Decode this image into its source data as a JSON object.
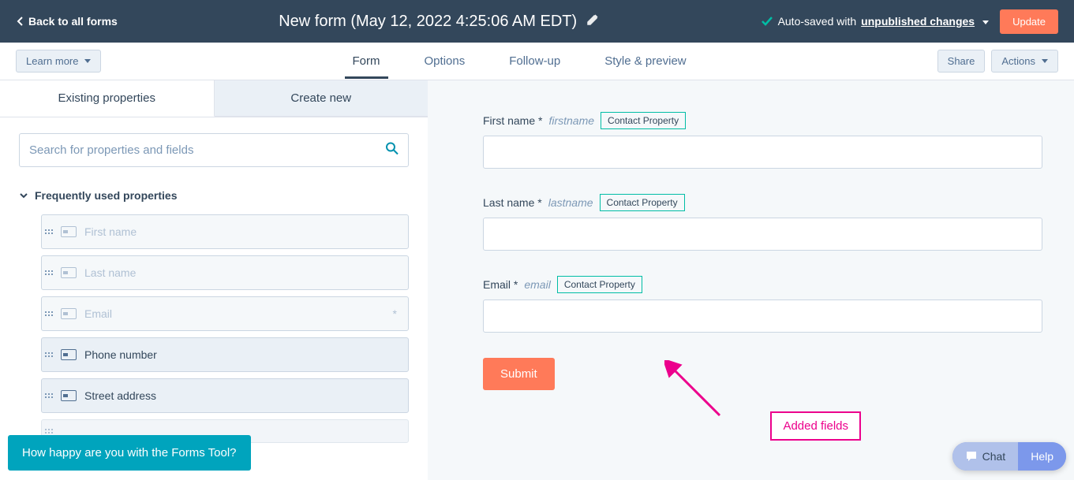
{
  "topbar": {
    "back_label": "Back to all forms",
    "title": "New form (May 12, 2022 4:25:06 AM EDT)",
    "autosave_prefix": "Auto-saved with ",
    "autosave_link": "unpublished changes",
    "update_label": "Update"
  },
  "secondbar": {
    "learn_more": "Learn more",
    "tabs": [
      {
        "label": "Form",
        "active": true
      },
      {
        "label": "Options",
        "active": false
      },
      {
        "label": "Follow-up",
        "active": false
      },
      {
        "label": "Style & preview",
        "active": false
      }
    ],
    "share": "Share",
    "actions": "Actions"
  },
  "left": {
    "tabs": {
      "existing": "Existing properties",
      "create": "Create new"
    },
    "search_placeholder": "Search for properties and fields",
    "group_header": "Frequently used properties",
    "items": [
      {
        "label": "First name",
        "disabled": true,
        "required": false
      },
      {
        "label": "Last name",
        "disabled": true,
        "required": false
      },
      {
        "label": "Email",
        "disabled": true,
        "required": true
      },
      {
        "label": "Phone number",
        "disabled": false,
        "required": false
      },
      {
        "label": "Street address",
        "disabled": false,
        "required": false
      }
    ]
  },
  "form_fields": [
    {
      "label": "First name",
      "required": true,
      "internal": "firstname",
      "badge": "Contact Property"
    },
    {
      "label": "Last name",
      "required": true,
      "internal": "lastname",
      "badge": "Contact Property"
    },
    {
      "label": "Email",
      "required": true,
      "internal": "email",
      "badge": "Contact Property"
    }
  ],
  "submit_label": "Submit",
  "annotation_text": "Added fields",
  "survey_text": "How happy are you with the Forms Tool?",
  "chat_label": "Chat",
  "help_label": "Help"
}
